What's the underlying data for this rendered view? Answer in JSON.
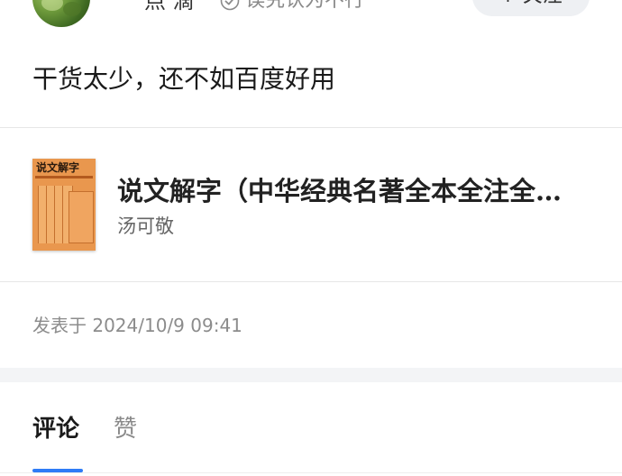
{
  "header": {
    "author_name": "点  滴",
    "author_note": "误究认为不行",
    "follow_label": "+ 关注"
  },
  "post": {
    "text": "干货太少，还不如百度好用"
  },
  "book": {
    "cover_title": "说文解字",
    "title": "说文解字（中华经典名著全本全注全…",
    "author": "汤可敬"
  },
  "meta": {
    "publish_time": "发表于 2024/10/9 09:41"
  },
  "tabs": [
    {
      "label": "评论",
      "active": true
    },
    {
      "label": "赞",
      "active": false
    }
  ],
  "colors": {
    "accent": "#2f7cf6",
    "cover": "#e9974e",
    "separator": "#f3f4f6"
  }
}
